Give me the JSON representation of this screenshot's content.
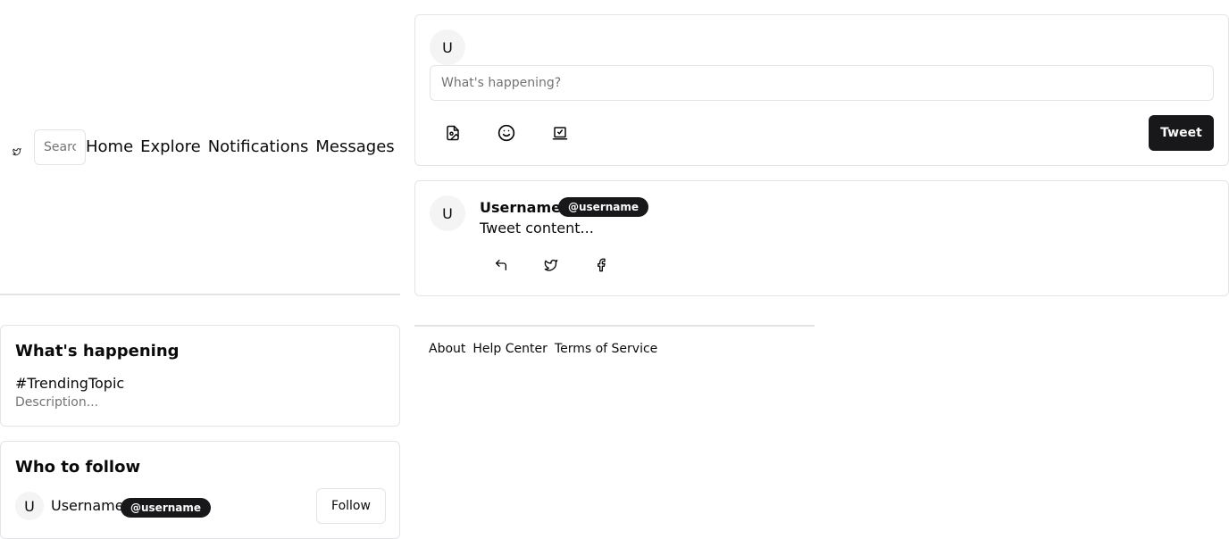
{
  "nav": {
    "logo_icon": "bird-icon",
    "search_placeholder": "Search",
    "links": [
      "Home",
      "Explore",
      "Notifications",
      "Messages"
    ]
  },
  "composer": {
    "avatar_initial": "U",
    "placeholder": "What's happening?",
    "tool_icons": [
      "image-icon",
      "smile-icon",
      "poll-icon"
    ],
    "tweet_label": "Tweet"
  },
  "tweet": {
    "avatar_initial": "U",
    "username": "Username",
    "handle": "@username",
    "content": "Tweet content...",
    "action_icons": [
      "reply-icon",
      "twitter-icon",
      "facebook-icon"
    ]
  },
  "footer": {
    "links": [
      "About",
      "Help Center",
      "Terms of Service"
    ]
  },
  "trending": {
    "title": "What's happening",
    "topic": "#TrendingTopic",
    "description": "Description..."
  },
  "who_to_follow": {
    "title": "Who to follow",
    "avatar_initial": "U",
    "username": "Username",
    "handle": "@username",
    "follow_label": "Follow"
  }
}
